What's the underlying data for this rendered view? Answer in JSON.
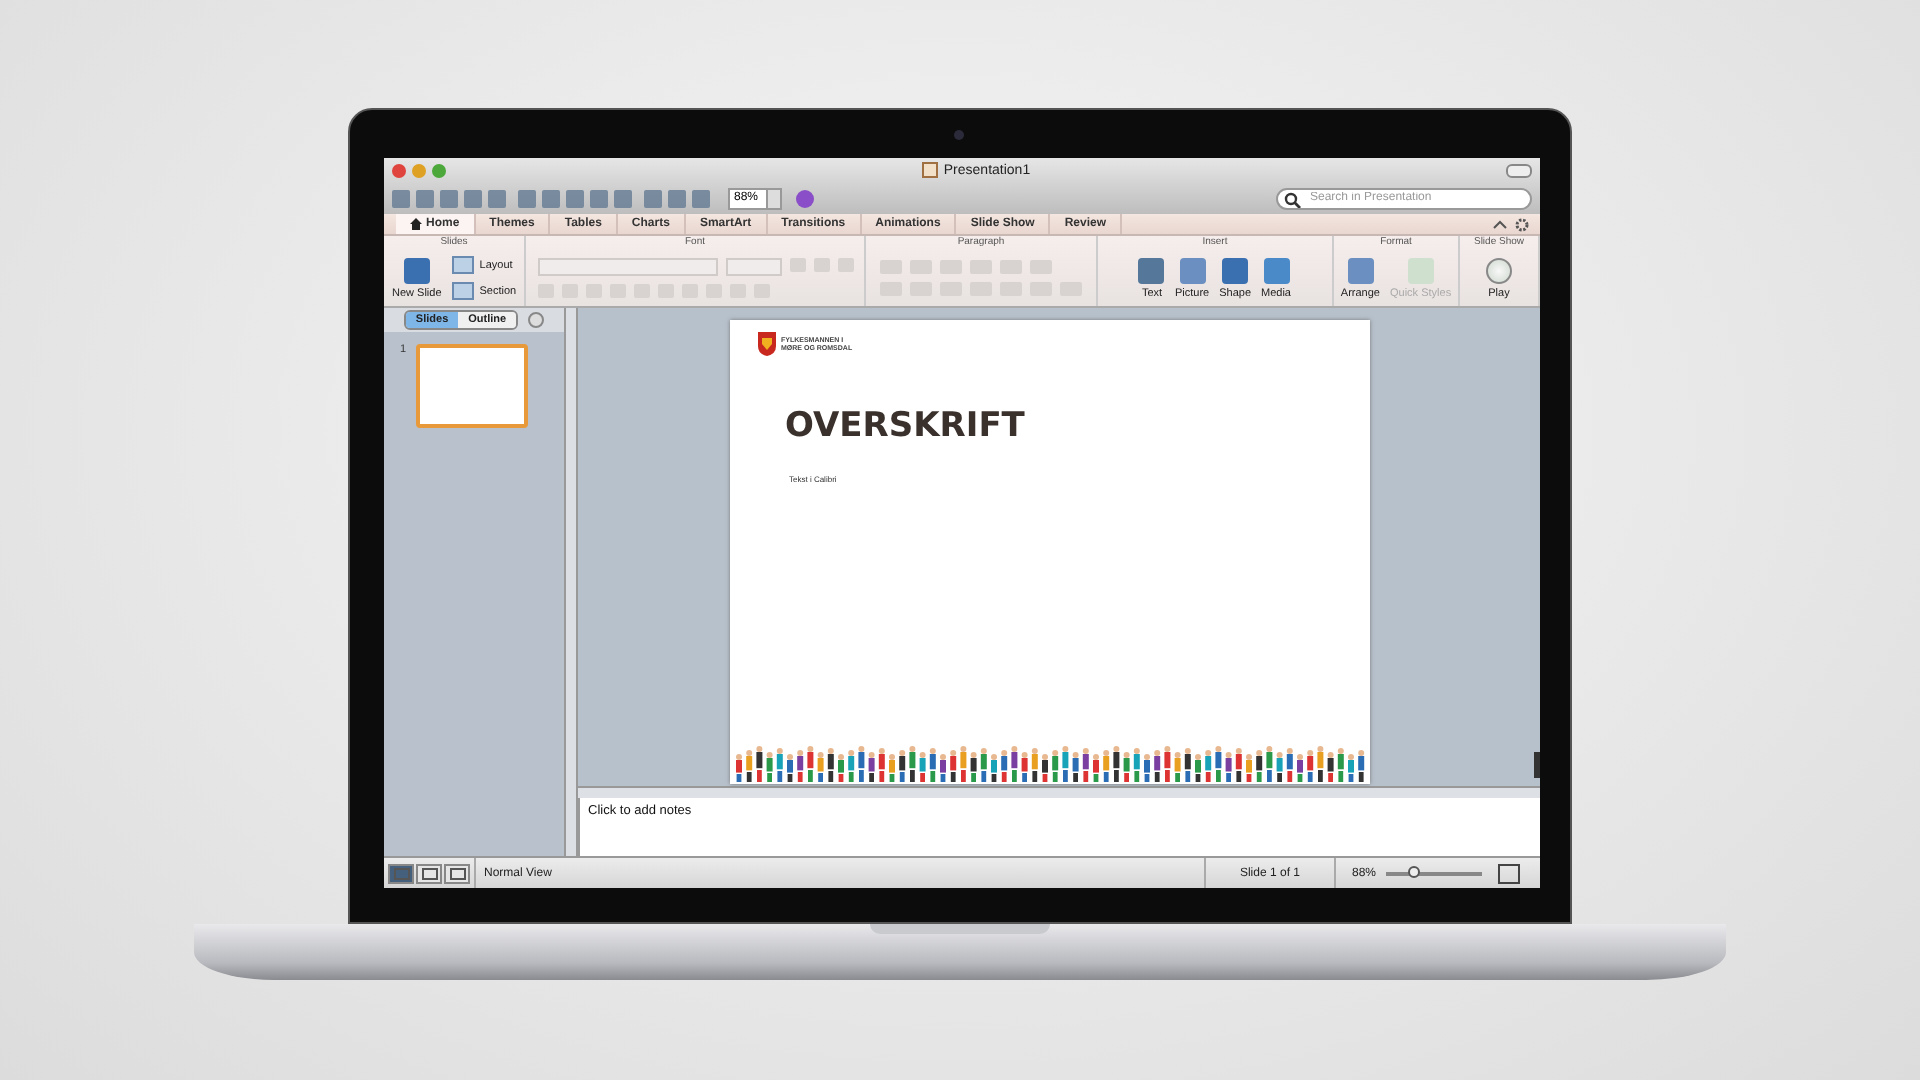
{
  "window": {
    "title": "Presentation1"
  },
  "toolbar": {
    "zoom": "88%",
    "search": {
      "placeholder": "Search in Presentation"
    }
  },
  "ribbon_tabs": [
    {
      "label": "Home",
      "selected": true
    },
    {
      "label": "Themes",
      "selected": false
    },
    {
      "label": "Tables",
      "selected": false
    },
    {
      "label": "Charts",
      "selected": false
    },
    {
      "label": "SmartArt",
      "selected": false
    },
    {
      "label": "Transitions",
      "selected": false
    },
    {
      "label": "Animations",
      "selected": false
    },
    {
      "label": "Slide Show",
      "selected": false
    },
    {
      "label": "Review",
      "selected": false
    }
  ],
  "ribbon_groups": [
    {
      "title": "Slides",
      "buttons": [
        {
          "label": "New Slide",
          "kind": "large",
          "disabled": false
        },
        {
          "label": "Layout",
          "kind": "small",
          "disabled": false
        },
        {
          "label": "Section",
          "kind": "small",
          "disabled": false
        }
      ]
    },
    {
      "title": "Font"
    },
    {
      "title": "Paragraph"
    },
    {
      "title": "Insert",
      "buttons": [
        {
          "label": "Text",
          "kind": "large",
          "disabled": false
        },
        {
          "label": "Picture",
          "kind": "large",
          "disabled": false
        },
        {
          "label": "Shape",
          "kind": "large",
          "disabled": false
        },
        {
          "label": "Media",
          "kind": "large",
          "disabled": false
        }
      ]
    },
    {
      "title": "Format",
      "buttons": [
        {
          "label": "Arrange",
          "kind": "large",
          "disabled": false
        },
        {
          "label": "Quick Styles",
          "kind": "large",
          "disabled": true
        }
      ]
    },
    {
      "title": "Slide Show",
      "buttons": [
        {
          "label": "Play",
          "kind": "large",
          "disabled": false
        }
      ]
    }
  ],
  "sidebar": {
    "tabs": [
      {
        "label": "Slides",
        "selected": true
      },
      {
        "label": "Outline",
        "selected": false
      }
    ],
    "thumbnails": [
      {
        "number": "1",
        "selected": true
      }
    ]
  },
  "slide": {
    "logo_text": [
      "FYLKESMANNEN I",
      "MØRE OG ROMSDAL"
    ],
    "title": "OVERSKRIFT",
    "subtitle": "Tekst i Calibri"
  },
  "notes": {
    "placeholder": "Click to add notes"
  },
  "status_bar": {
    "views": [
      {
        "selected": true
      },
      {
        "selected": false
      },
      {
        "selected": false
      }
    ],
    "view_name": "Normal View",
    "slide_position": "Slide 1 of 1",
    "zoom": "88%",
    "zoom_slider": {
      "level": 0.3
    }
  }
}
